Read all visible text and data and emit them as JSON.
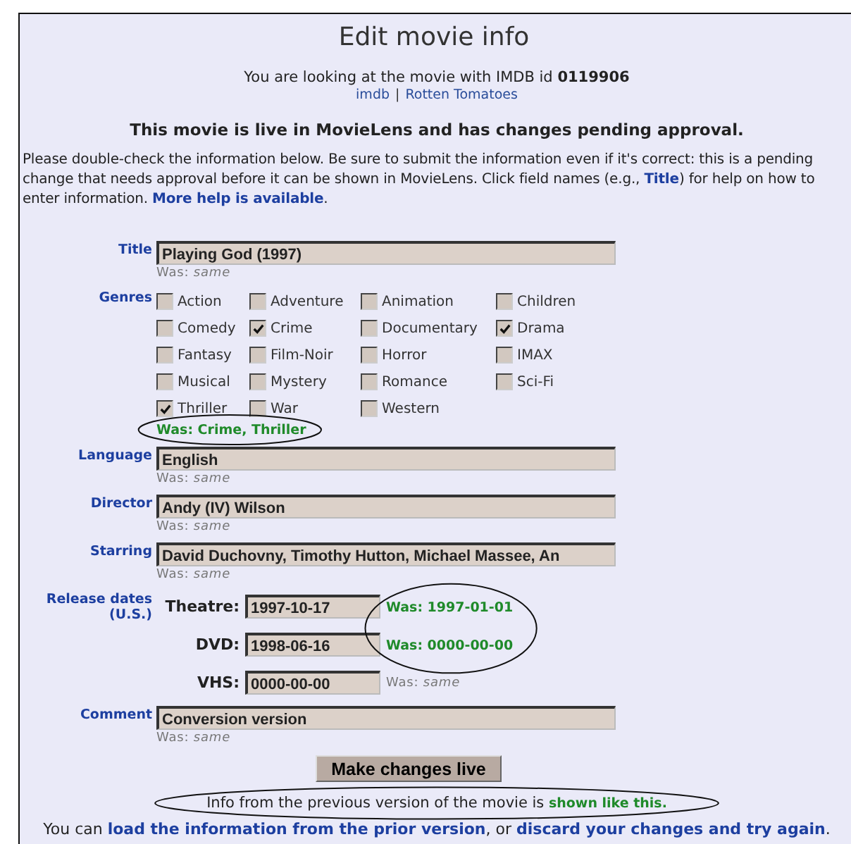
{
  "title": "Edit movie info",
  "intro": {
    "text": "You are looking at the movie with IMDB id **0119906**",
    "links": [
      "imdb",
      "Rotten Tomatoes"
    ],
    "separator": "|"
  },
  "status": "This movie is live in MovieLens and has changes pending approval.",
  "instructions": [
    {
      "kind": "text",
      "text": "Please double-check the information below. Be sure to submit the information even if it's correct: this is a pending change that needs approval before it can be shown in MovieLens. Click field names (e.g., "
    },
    {
      "kind": "link",
      "text": "Title"
    },
    {
      "kind": "text",
      "text": ") for help on how to enter information. "
    },
    {
      "kind": "link",
      "text": "More help is available"
    },
    {
      "kind": "text",
      "text": "."
    }
  ],
  "fields": [
    {
      "kind": "text",
      "label": "Title",
      "value": "Playing God (1997)",
      "was": {
        "text": "Was: *same*",
        "changed": false
      }
    },
    {
      "kind": "genres",
      "label": "Genres",
      "genres": [
        {
          "label": "Action",
          "checked": false
        },
        {
          "label": "Adventure",
          "checked": false
        },
        {
          "label": "Animation",
          "checked": false
        },
        {
          "label": "Children",
          "checked": false
        },
        {
          "label": "Comedy",
          "checked": false
        },
        {
          "label": "Crime",
          "checked": true
        },
        {
          "label": "Documentary",
          "checked": false
        },
        {
          "label": "Drama",
          "checked": true
        },
        {
          "label": "Fantasy",
          "checked": false
        },
        {
          "label": "Film-Noir",
          "checked": false
        },
        {
          "label": "Horror",
          "checked": false
        },
        {
          "label": "IMAX",
          "checked": false
        },
        {
          "label": "Musical",
          "checked": false
        },
        {
          "label": "Mystery",
          "checked": false
        },
        {
          "label": "Romance",
          "checked": false
        },
        {
          "label": "Sci-Fi",
          "checked": false
        },
        {
          "label": "Thriller",
          "checked": true
        },
        {
          "label": "War",
          "checked": false
        },
        {
          "label": "Western",
          "checked": false
        }
      ],
      "was": {
        "text": "Was: Crime, Thriller",
        "changed": true
      }
    },
    {
      "kind": "text",
      "label": "Language",
      "value": "English",
      "was": {
        "text": "Was: *same*",
        "changed": false
      }
    },
    {
      "kind": "text",
      "label": "Director",
      "value": "Andy (IV) Wilson",
      "was": {
        "text": "Was: *same*",
        "changed": false
      }
    },
    {
      "kind": "text",
      "label": "Starring",
      "value": "David Duchovny, Timothy Hutton, Michael Massee, An",
      "was": {
        "text": "Was: *same*",
        "changed": false
      }
    },
    {
      "kind": "dates",
      "label": "Release dates (U.S.)",
      "dates": [
        {
          "label": "Theatre:",
          "value": "1997-10-17",
          "was": {
            "text": "Was: 1997-01-01",
            "changed": true
          }
        },
        {
          "label": "DVD:",
          "value": "1998-06-16",
          "was": {
            "text": "Was: 0000-00-00",
            "changed": true
          }
        },
        {
          "label": "VHS:",
          "value": "0000-00-00",
          "was": {
            "text": "Was: *same*",
            "changed": false
          }
        }
      ]
    },
    {
      "kind": "text",
      "label": "Comment",
      "value": "Conversion version",
      "was": {
        "text": "Was: *same*",
        "changed": false
      }
    }
  ],
  "submit": "Make changes live",
  "legend": "Info from the previous version of the movie is **shown like this.**",
  "footer": [
    {
      "kind": "text",
      "text": "You can "
    },
    {
      "kind": "link",
      "text": "load the information from the prior version"
    },
    {
      "kind": "text",
      "text": ", or "
    },
    {
      "kind": "link",
      "text": "discard your changes and try again"
    },
    {
      "kind": "text",
      "text": "."
    }
  ]
}
